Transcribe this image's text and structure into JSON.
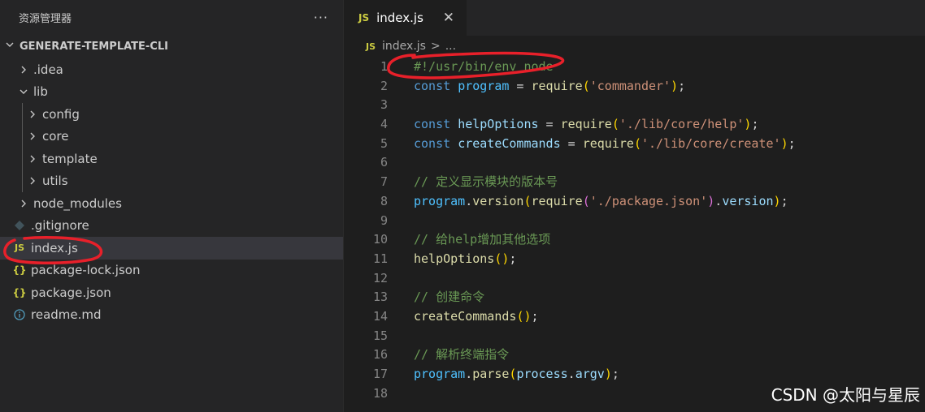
{
  "sidebar": {
    "title": "资源管理器",
    "more": "···",
    "section": "GENERATE-TEMPLATE-CLI",
    "items": [
      {
        "label": ".idea",
        "kind": "folder",
        "depth": 0,
        "expanded": false
      },
      {
        "label": "lib",
        "kind": "folder",
        "depth": 0,
        "expanded": true
      },
      {
        "label": "config",
        "kind": "folder",
        "depth": 1,
        "expanded": false
      },
      {
        "label": "core",
        "kind": "folder",
        "depth": 1,
        "expanded": false
      },
      {
        "label": "template",
        "kind": "folder",
        "depth": 1,
        "expanded": false
      },
      {
        "label": "utils",
        "kind": "folder",
        "depth": 1,
        "expanded": false
      },
      {
        "label": "node_modules",
        "kind": "folder",
        "depth": 0,
        "expanded": false
      },
      {
        "label": ".gitignore",
        "kind": "git",
        "depth": 0
      },
      {
        "label": "index.js",
        "kind": "js",
        "depth": 0,
        "active": true
      },
      {
        "label": "package-lock.json",
        "kind": "json",
        "depth": 0
      },
      {
        "label": "package.json",
        "kind": "json",
        "depth": 0
      },
      {
        "label": "readme.md",
        "kind": "info",
        "depth": 0
      }
    ]
  },
  "icons": {
    "chevron_right": "chevron-right-icon",
    "chevron_down": "chevron-down-icon",
    "js": "js-file-icon",
    "json": "json-file-icon",
    "git": "git-file-icon",
    "info": "info-file-icon",
    "close": "close-icon",
    "more": "more-icon"
  },
  "js_badge": "JS",
  "json_badge": "{}",
  "tab": {
    "label": "index.js",
    "close": "✕"
  },
  "breadcrumb": {
    "file": "index.js",
    "separator": ">",
    "more": "..."
  },
  "code_lines": [
    {
      "n": "1",
      "tokens": [
        {
          "t": "#!/usr/bin/env node",
          "c": "comment"
        }
      ]
    },
    {
      "n": "2",
      "tokens": [
        {
          "t": "const",
          "c": "kw"
        },
        {
          "t": " ",
          "c": "punct"
        },
        {
          "t": "program",
          "c": "var"
        },
        {
          "t": " = ",
          "c": "punct"
        },
        {
          "t": "require",
          "c": "fn"
        },
        {
          "t": "(",
          "c": "paren"
        },
        {
          "t": "'commander'",
          "c": "str"
        },
        {
          "t": ")",
          "c": "paren"
        },
        {
          "t": ";",
          "c": "punct"
        }
      ]
    },
    {
      "n": "3",
      "tokens": []
    },
    {
      "n": "4",
      "tokens": [
        {
          "t": "const",
          "c": "kw"
        },
        {
          "t": " ",
          "c": "punct"
        },
        {
          "t": "helpOptions",
          "c": "plain"
        },
        {
          "t": " = ",
          "c": "punct"
        },
        {
          "t": "require",
          "c": "fn"
        },
        {
          "t": "(",
          "c": "paren"
        },
        {
          "t": "'./lib/core/help'",
          "c": "str"
        },
        {
          "t": ")",
          "c": "paren"
        },
        {
          "t": ";",
          "c": "punct"
        }
      ]
    },
    {
      "n": "5",
      "tokens": [
        {
          "t": "const",
          "c": "kw"
        },
        {
          "t": " ",
          "c": "punct"
        },
        {
          "t": "createCommands",
          "c": "plain"
        },
        {
          "t": " = ",
          "c": "punct"
        },
        {
          "t": "require",
          "c": "fn"
        },
        {
          "t": "(",
          "c": "paren"
        },
        {
          "t": "'./lib/core/create'",
          "c": "str"
        },
        {
          "t": ")",
          "c": "paren"
        },
        {
          "t": ";",
          "c": "punct"
        }
      ]
    },
    {
      "n": "6",
      "tokens": []
    },
    {
      "n": "7",
      "tokens": [
        {
          "t": "// 定义显示模块的版本号",
          "c": "comment"
        }
      ]
    },
    {
      "n": "8",
      "tokens": [
        {
          "t": "program",
          "c": "var"
        },
        {
          "t": ".",
          "c": "punct"
        },
        {
          "t": "version",
          "c": "fn"
        },
        {
          "t": "(",
          "c": "paren"
        },
        {
          "t": "require",
          "c": "fn"
        },
        {
          "t": "(",
          "c": "paren2"
        },
        {
          "t": "'./package.json'",
          "c": "str"
        },
        {
          "t": ")",
          "c": "paren2"
        },
        {
          "t": ".",
          "c": "punct"
        },
        {
          "t": "version",
          "c": "prop"
        },
        {
          "t": ")",
          "c": "paren"
        },
        {
          "t": ";",
          "c": "punct"
        }
      ]
    },
    {
      "n": "9",
      "tokens": []
    },
    {
      "n": "10",
      "tokens": [
        {
          "t": "// 给help增加其他选项",
          "c": "comment"
        }
      ]
    },
    {
      "n": "11",
      "tokens": [
        {
          "t": "helpOptions",
          "c": "fn"
        },
        {
          "t": "()",
          "c": "paren"
        },
        {
          "t": ";",
          "c": "punct"
        }
      ]
    },
    {
      "n": "12",
      "tokens": []
    },
    {
      "n": "13",
      "tokens": [
        {
          "t": "// 创建命令",
          "c": "comment"
        }
      ]
    },
    {
      "n": "14",
      "tokens": [
        {
          "t": "createCommands",
          "c": "fn"
        },
        {
          "t": "()",
          "c": "paren"
        },
        {
          "t": ";",
          "c": "punct"
        }
      ]
    },
    {
      "n": "15",
      "tokens": []
    },
    {
      "n": "16",
      "tokens": [
        {
          "t": "// 解析终端指令",
          "c": "comment"
        }
      ]
    },
    {
      "n": "17",
      "tokens": [
        {
          "t": "program",
          "c": "var"
        },
        {
          "t": ".",
          "c": "punct"
        },
        {
          "t": "parse",
          "c": "fn"
        },
        {
          "t": "(",
          "c": "paren"
        },
        {
          "t": "process",
          "c": "plain"
        },
        {
          "t": ".",
          "c": "punct"
        },
        {
          "t": "argv",
          "c": "prop"
        },
        {
          "t": ")",
          "c": "paren"
        },
        {
          "t": ";",
          "c": "punct"
        }
      ]
    },
    {
      "n": "18",
      "tokens": []
    }
  ],
  "watermark": "CSDN @太阳与星辰",
  "colors": {
    "annotation": "#e8202a",
    "sidebar_bg": "#252526",
    "editor_bg": "#1e1e1e",
    "active_row": "#37373d",
    "js_icon": "#cbcb41",
    "json_icon": "#cbcb41",
    "git_icon": "#41535b",
    "info_icon": "#519aba"
  }
}
